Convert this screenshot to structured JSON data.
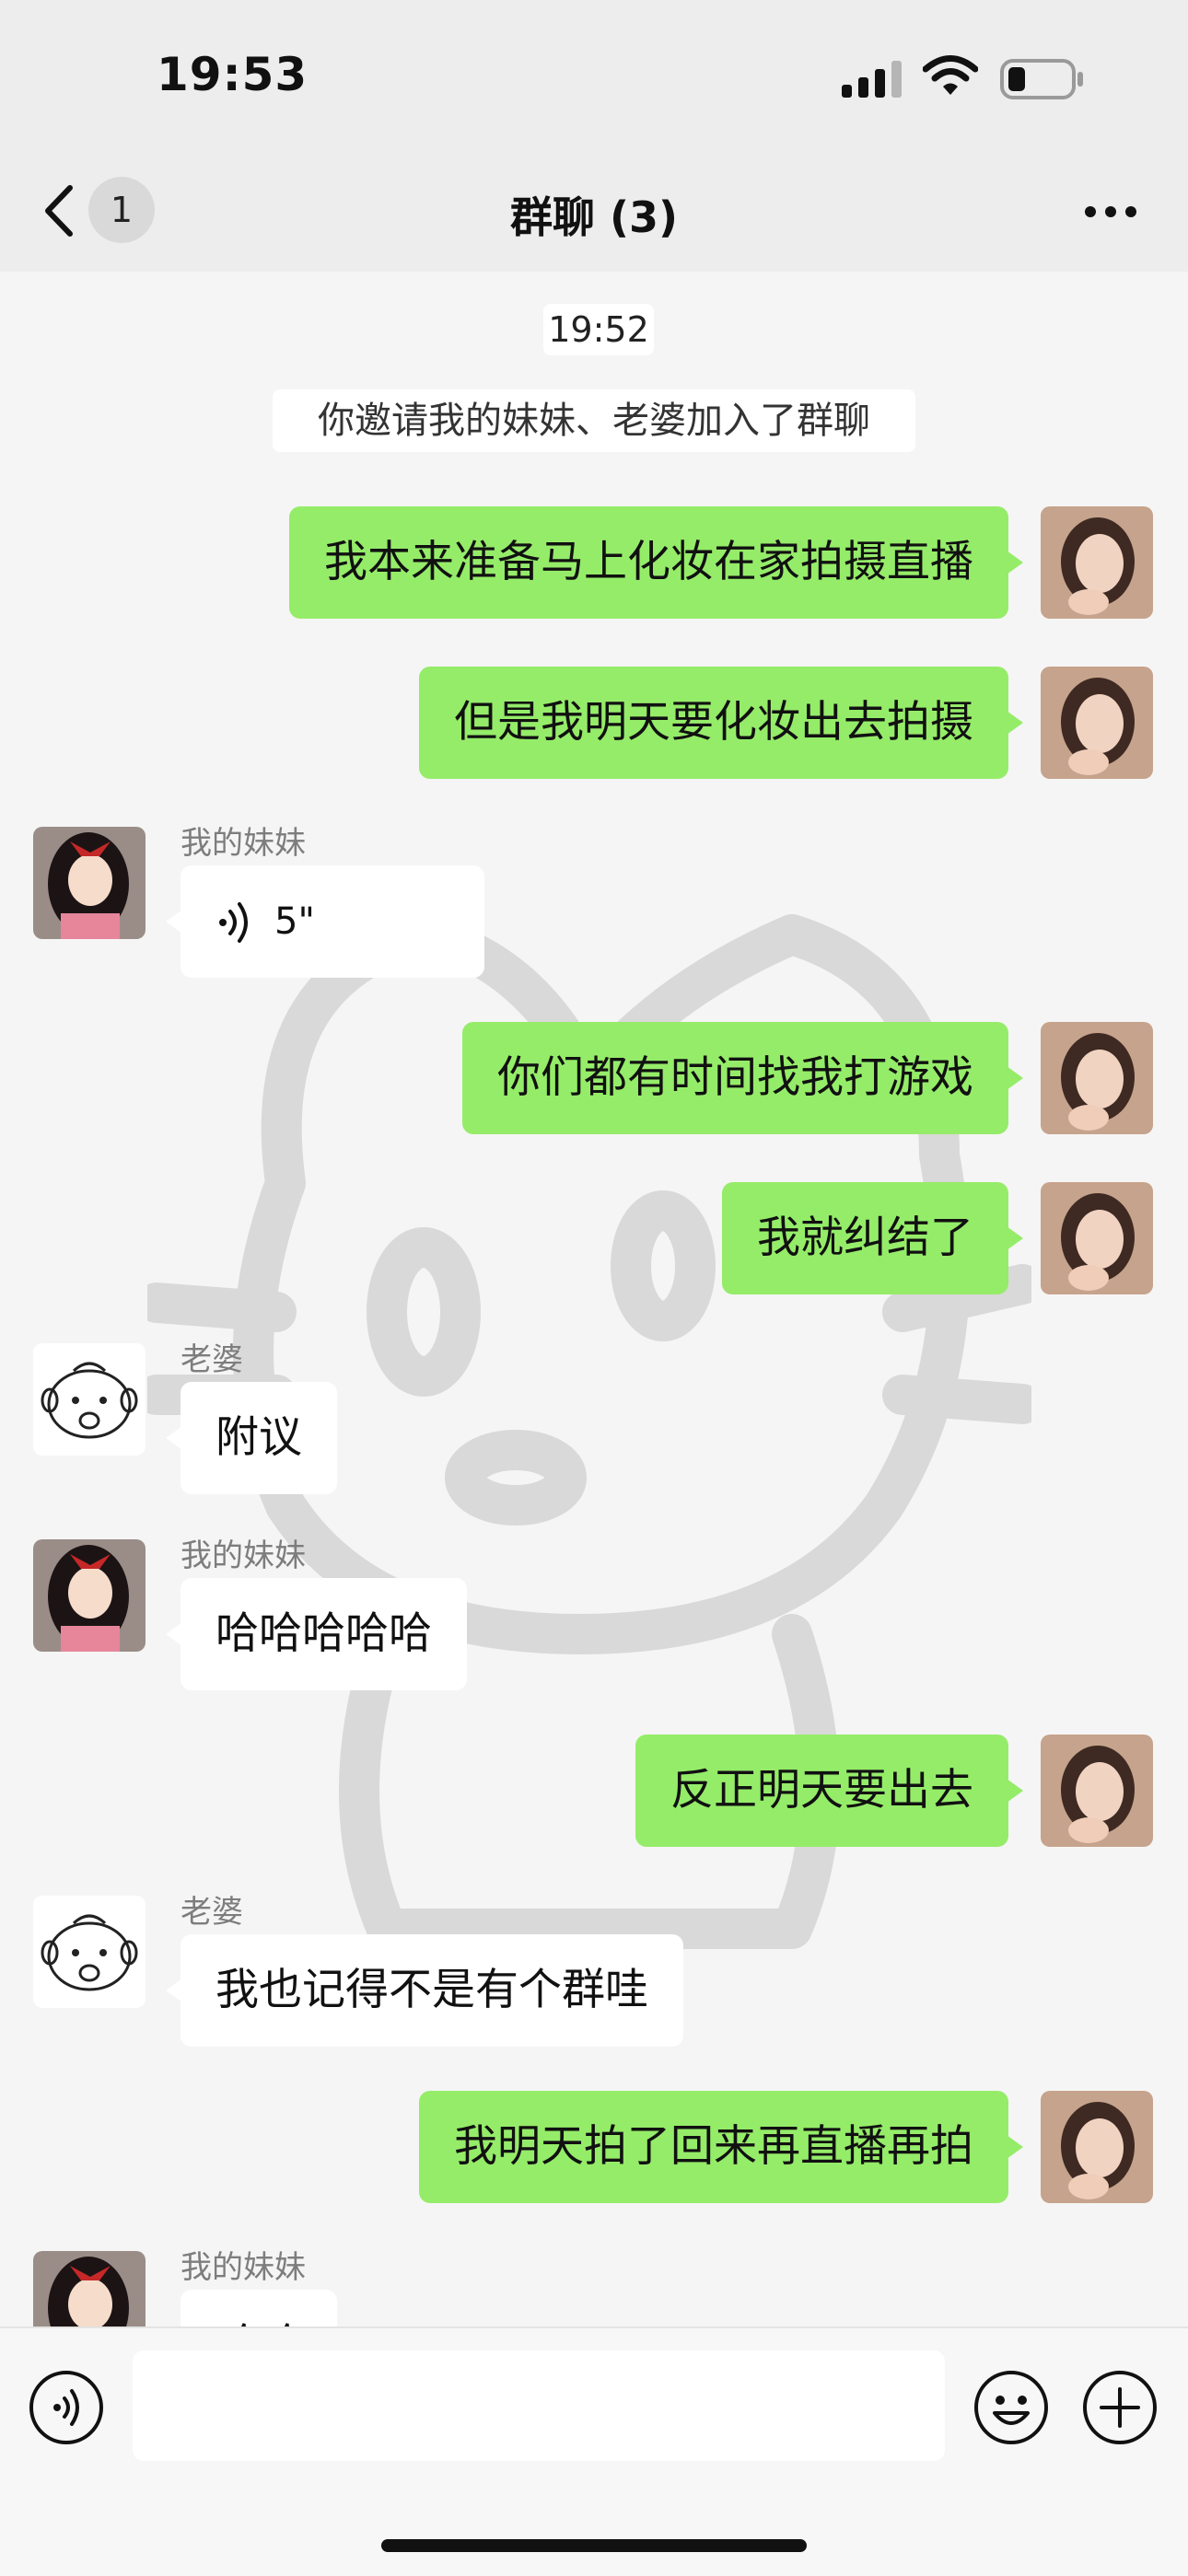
{
  "status_bar": {
    "time": "19:53"
  },
  "nav": {
    "badge": "1",
    "title": "群聊 (3)"
  },
  "chat": {
    "timestamp": "19:52",
    "system_notice": "你邀请我的妹妹、老婆加入了群聊",
    "messages": [
      {
        "side": "out",
        "text": "我本来准备马上化妆在家拍摄直播"
      },
      {
        "side": "out",
        "text": "但是我明天要化妆出去拍摄"
      },
      {
        "side": "in",
        "sender": "我的妹妹",
        "voice": "5\""
      },
      {
        "side": "out",
        "text": "你们都有时间找我打游戏"
      },
      {
        "side": "out",
        "text": "我就纠结了"
      },
      {
        "side": "in",
        "sender": "老婆",
        "text": "附议"
      },
      {
        "side": "in",
        "sender": "我的妹妹",
        "text": "哈哈哈哈哈"
      },
      {
        "side": "out",
        "text": "反正明天要出去"
      },
      {
        "side": "in",
        "sender": "老婆",
        "text": "我也记得不是有个群哇"
      },
      {
        "side": "out",
        "text": "我明天拍了回来再直播再拍"
      },
      {
        "side": "in",
        "sender": "我的妹妹",
        "text": "哈哈"
      }
    ]
  },
  "colors": {
    "outgoing_bubble": "#95ec69",
    "incoming_bubble": "#ffffff",
    "background": "#f5f5f5"
  },
  "icons": [
    "signal-icon",
    "wifi-icon",
    "battery-icon",
    "back-icon",
    "more-icon",
    "voice-wave-icon",
    "emoji-icon",
    "plus-icon"
  ]
}
